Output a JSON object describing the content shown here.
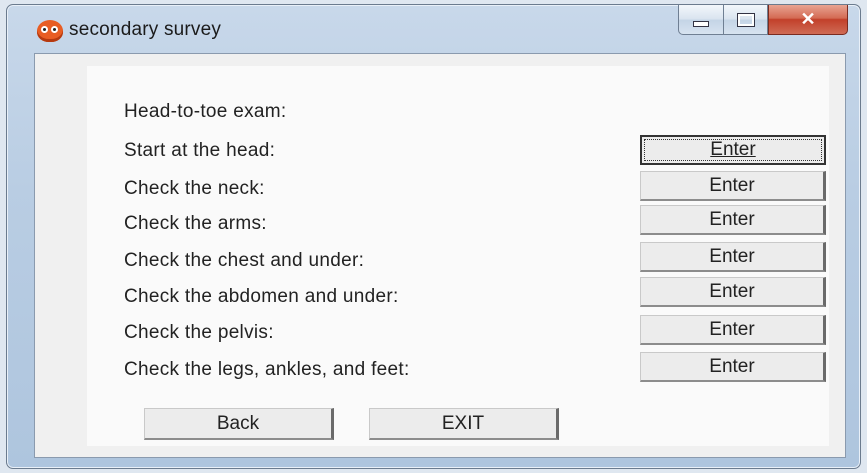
{
  "window": {
    "title": "secondary survey",
    "app_icon": "owl-icon",
    "minimize_icon": "minimize-icon",
    "maximize_icon": "maximize-icon",
    "close_label": "✕"
  },
  "heading": "Head-to-toe exam:",
  "rows": [
    {
      "label": "Start at the head:",
      "button": "Enter"
    },
    {
      "label": "Check the neck:",
      "button": "Enter"
    },
    {
      "label": "Check the arms:",
      "button": "Enter"
    },
    {
      "label": "Check the chest and under:",
      "button": "Enter"
    },
    {
      "label": "Check the abdomen and under:",
      "button": "Enter"
    },
    {
      "label": "Check the pelvis:",
      "button": "Enter"
    },
    {
      "label": "Check the legs, ankles, and feet:",
      "button": "Enter"
    }
  ],
  "footer": {
    "back_label": "Back",
    "exit_label": "EXIT"
  }
}
